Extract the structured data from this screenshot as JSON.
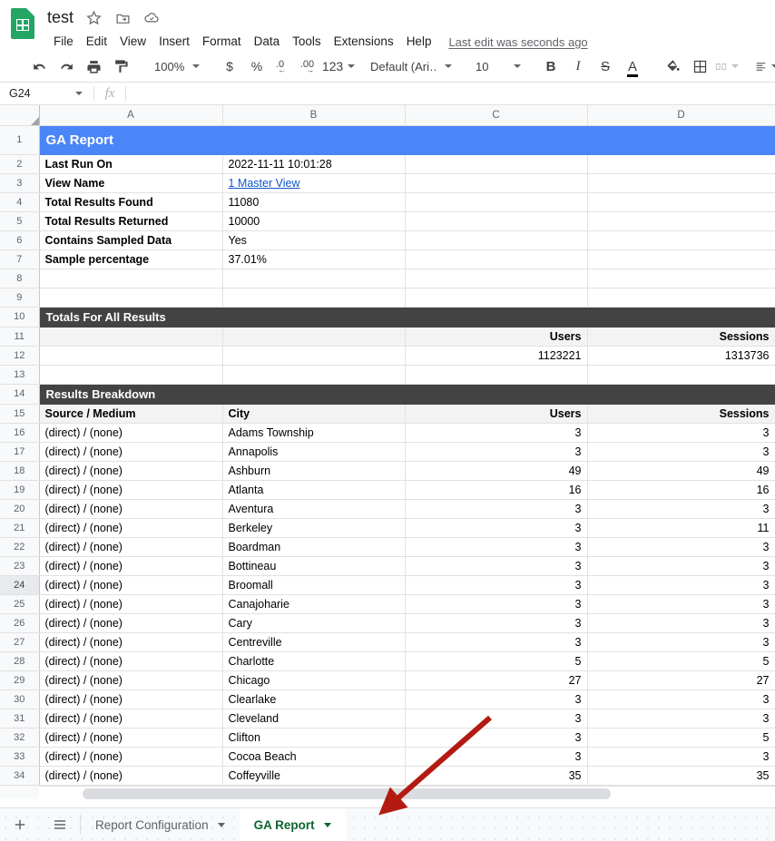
{
  "app": {
    "doc_title": "test",
    "logo_icon": "google-sheets-icon",
    "star_icon": "star-icon",
    "move_icon": "move-to-folder-icon",
    "cloud_icon": "drive-saved-cloud-icon",
    "last_edit": "Last edit was seconds ago"
  },
  "menu": [
    {
      "label": "File"
    },
    {
      "label": "Edit"
    },
    {
      "label": "View"
    },
    {
      "label": "Insert"
    },
    {
      "label": "Format"
    },
    {
      "label": "Data"
    },
    {
      "label": "Tools"
    },
    {
      "label": "Extensions"
    },
    {
      "label": "Help"
    }
  ],
  "toolbar": {
    "undo_icon": "undo-icon",
    "redo_icon": "redo-icon",
    "print_icon": "print-icon",
    "paint_format_icon": "paint-format-icon",
    "zoom_value": "100%",
    "currency_label": "$",
    "percent_label": "%",
    "decrease_decimal_label": ".0",
    "increase_decimal_label": ".00",
    "more_formats_label": "123",
    "font_family": "Default (Ari…",
    "font_size": "10",
    "bold_label": "B",
    "italic_label": "I",
    "strikethrough_label": "S",
    "text_color_label": "A",
    "fill_color_icon": "fill-color-icon",
    "borders_icon": "borders-icon",
    "merge_cells_icon": "merge-cells-icon",
    "align_icon": "horizontal-align-icon"
  },
  "formula_bar": {
    "name_box": "G24",
    "fx_label": "fx",
    "formula_value": ""
  },
  "grid": {
    "columns": [
      "A",
      "B",
      "C",
      "D"
    ],
    "rows": [
      {
        "n": "1",
        "type": "band-blue",
        "text": "GA Report"
      },
      {
        "n": "2",
        "type": "kv",
        "a": "Last Run On",
        "b": "2022-11-11 10:01:28",
        "c": "",
        "d": ""
      },
      {
        "n": "3",
        "type": "link",
        "a": "View Name",
        "b": "1 Master View",
        "c": "",
        "d": ""
      },
      {
        "n": "4",
        "type": "kv",
        "a": "Total Results Found",
        "b": "11080",
        "c": "",
        "d": ""
      },
      {
        "n": "5",
        "type": "kv",
        "a": "Total Results Returned",
        "b": "10000",
        "c": "",
        "d": ""
      },
      {
        "n": "6",
        "type": "kv",
        "a": "Contains Sampled Data",
        "b": "Yes",
        "c": "",
        "d": ""
      },
      {
        "n": "7",
        "type": "kv",
        "a": "Sample percentage",
        "b": "37.01%",
        "c": "",
        "d": ""
      },
      {
        "n": "8",
        "type": "blank",
        "a": "",
        "b": "",
        "c": "",
        "d": ""
      },
      {
        "n": "9",
        "type": "blank",
        "a": "",
        "b": "",
        "c": "",
        "d": ""
      },
      {
        "n": "10",
        "type": "band-dark",
        "text": "Totals For All Results"
      },
      {
        "n": "11",
        "type": "header",
        "a": "",
        "b": "",
        "c": "Users",
        "d": "Sessions"
      },
      {
        "n": "12",
        "type": "data",
        "a": "",
        "b": "",
        "c": "1123221",
        "d": "1313736"
      },
      {
        "n": "13",
        "type": "blank",
        "a": "",
        "b": "",
        "c": "",
        "d": ""
      },
      {
        "n": "14",
        "type": "band-dark",
        "text": "Results Breakdown"
      },
      {
        "n": "15",
        "type": "header",
        "a": "Source / Medium",
        "b": "City",
        "c": "Users",
        "d": "Sessions"
      },
      {
        "n": "16",
        "type": "data",
        "a": "(direct) / (none)",
        "b": "Adams Township",
        "c": "3",
        "d": "3"
      },
      {
        "n": "17",
        "type": "data",
        "a": "(direct) / (none)",
        "b": "Annapolis",
        "c": "3",
        "d": "3"
      },
      {
        "n": "18",
        "type": "data",
        "a": "(direct) / (none)",
        "b": "Ashburn",
        "c": "49",
        "d": "49"
      },
      {
        "n": "19",
        "type": "data",
        "a": "(direct) / (none)",
        "b": "Atlanta",
        "c": "16",
        "d": "16"
      },
      {
        "n": "20",
        "type": "data",
        "a": "(direct) / (none)",
        "b": "Aventura",
        "c": "3",
        "d": "3"
      },
      {
        "n": "21",
        "type": "data",
        "a": "(direct) / (none)",
        "b": "Berkeley",
        "c": "3",
        "d": "11"
      },
      {
        "n": "22",
        "type": "data",
        "a": "(direct) / (none)",
        "b": "Boardman",
        "c": "3",
        "d": "3"
      },
      {
        "n": "23",
        "type": "data",
        "a": "(direct) / (none)",
        "b": "Bottineau",
        "c": "3",
        "d": "3"
      },
      {
        "n": "24",
        "type": "data",
        "a": "(direct) / (none)",
        "b": "Broomall",
        "c": "3",
        "d": "3",
        "selected": true
      },
      {
        "n": "25",
        "type": "data",
        "a": "(direct) / (none)",
        "b": "Canajoharie",
        "c": "3",
        "d": "3"
      },
      {
        "n": "26",
        "type": "data",
        "a": "(direct) / (none)",
        "b": "Cary",
        "c": "3",
        "d": "3"
      },
      {
        "n": "27",
        "type": "data",
        "a": "(direct) / (none)",
        "b": "Centreville",
        "c": "3",
        "d": "3"
      },
      {
        "n": "28",
        "type": "data",
        "a": "(direct) / (none)",
        "b": "Charlotte",
        "c": "5",
        "d": "5"
      },
      {
        "n": "29",
        "type": "data",
        "a": "(direct) / (none)",
        "b": "Chicago",
        "c": "27",
        "d": "27"
      },
      {
        "n": "30",
        "type": "data",
        "a": "(direct) / (none)",
        "b": "Clearlake",
        "c": "3",
        "d": "3"
      },
      {
        "n": "31",
        "type": "data",
        "a": "(direct) / (none)",
        "b": "Cleveland",
        "c": "3",
        "d": "3"
      },
      {
        "n": "32",
        "type": "data",
        "a": "(direct) / (none)",
        "b": "Clifton",
        "c": "3",
        "d": "5"
      },
      {
        "n": "33",
        "type": "data",
        "a": "(direct) / (none)",
        "b": "Cocoa Beach",
        "c": "3",
        "d": "3"
      },
      {
        "n": "34",
        "type": "data",
        "a": "(direct) / (none)",
        "b": "Coffeyville",
        "c": "35",
        "d": "35"
      }
    ]
  },
  "sheetbar": {
    "add_sheet_icon": "add-sheet-icon",
    "all_sheets_icon": "all-sheets-list-icon",
    "tabs": [
      {
        "label": "Report Configuration",
        "active": false
      },
      {
        "label": "GA Report",
        "active": true
      }
    ]
  },
  "annotation": {
    "arrow_color": "#b31b12",
    "arrow_name": "red-pointer-arrow"
  },
  "colors": {
    "title_band": "#4a86f7",
    "section_band": "#434343",
    "link": "#1155cc",
    "active_tab_text": "#0d652d",
    "sheets_green": "#23a566"
  }
}
